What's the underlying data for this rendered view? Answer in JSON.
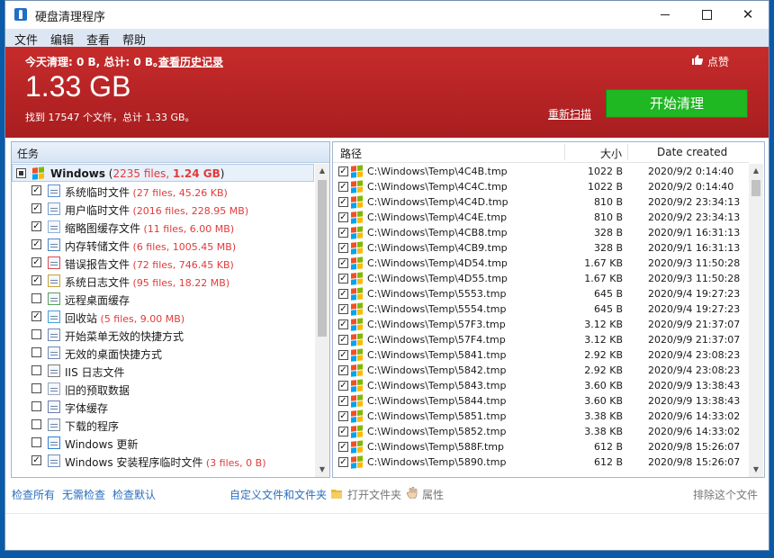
{
  "window": {
    "title": "硬盘清理程序"
  },
  "menu": [
    "文件",
    "编辑",
    "查看",
    "帮助"
  ],
  "banner": {
    "today": "今天清理: 0 B, 总计: 0 B。",
    "history": "查看历史记录",
    "like": "点赞",
    "total_size": "1.33 GB",
    "found": "找到 17547 个文件，总计 1.33 GB。",
    "rescan": "重新扫描",
    "start": "开始清理",
    "start_color": "#1fb722",
    "banner_color": "#b82426"
  },
  "tasks": {
    "header": "任务",
    "root": {
      "label": "Windows",
      "files": "2235 files,",
      "size": "1.24 GB"
    },
    "items": [
      {
        "label": "系统临时文件",
        "checked": true,
        "files": "27 files,",
        "size": "45.26 KB",
        "icon": "temp-icon"
      },
      {
        "label": "用户临时文件",
        "checked": true,
        "files": "2016 files,",
        "size": "228.95 MB",
        "icon": "user-temp-icon"
      },
      {
        "label": "缩略图缓存文件",
        "checked": true,
        "files": "11 files,",
        "size": "6.00 MB",
        "icon": "thumbnail-icon"
      },
      {
        "label": "内存转储文件",
        "checked": true,
        "files": "6 files,",
        "size": "1005.45 MB",
        "icon": "memory-dump-icon"
      },
      {
        "label": "错误报告文件",
        "checked": true,
        "files": "72 files,",
        "size": "746.45 KB",
        "icon": "error-report-icon"
      },
      {
        "label": "系统日志文件",
        "checked": true,
        "files": "95 files,",
        "size": "18.22 MB",
        "icon": "log-icon"
      },
      {
        "label": "远程桌面缓存",
        "checked": false,
        "files": "",
        "size": "",
        "icon": "remote-desktop-icon"
      },
      {
        "label": "回收站",
        "checked": true,
        "files": "5 files,",
        "size": "9.00 MB",
        "icon": "recycle-bin-icon"
      },
      {
        "label": "开始菜单无效的快捷方式",
        "checked": false,
        "files": "",
        "size": "",
        "icon": "shortcut-icon"
      },
      {
        "label": "无效的桌面快捷方式",
        "checked": false,
        "files": "",
        "size": "",
        "icon": "shortcut-icon"
      },
      {
        "label": "IIS 日志文件",
        "checked": false,
        "files": "",
        "size": "",
        "icon": "iis-log-icon"
      },
      {
        "label": "旧的预取数据",
        "checked": false,
        "files": "",
        "size": "",
        "icon": "prefetch-icon"
      },
      {
        "label": "字体缓存",
        "checked": false,
        "files": "",
        "size": "",
        "icon": "font-icon"
      },
      {
        "label": "下载的程序",
        "checked": false,
        "files": "",
        "size": "",
        "icon": "download-icon"
      },
      {
        "label": "Windows 更新",
        "checked": false,
        "files": "",
        "size": "",
        "icon": "windows-update-icon"
      },
      {
        "label": "Windows 安装程序临时文件",
        "checked": true,
        "files": "3 files,",
        "size": "0 B",
        "icon": "installer-icon"
      }
    ]
  },
  "files": {
    "col_path": "路径",
    "col_size": "大小",
    "col_date": "Date created",
    "rows": [
      {
        "path": "C:\\Windows\\Temp\\4C4B.tmp",
        "size": "1022 B",
        "date": "2020/9/2 0:14:40"
      },
      {
        "path": "C:\\Windows\\Temp\\4C4C.tmp",
        "size": "1022 B",
        "date": "2020/9/2 0:14:40"
      },
      {
        "path": "C:\\Windows\\Temp\\4C4D.tmp",
        "size": "810 B",
        "date": "2020/9/2 23:34:13"
      },
      {
        "path": "C:\\Windows\\Temp\\4C4E.tmp",
        "size": "810 B",
        "date": "2020/9/2 23:34:13"
      },
      {
        "path": "C:\\Windows\\Temp\\4CB8.tmp",
        "size": "328 B",
        "date": "2020/9/1 16:31:13"
      },
      {
        "path": "C:\\Windows\\Temp\\4CB9.tmp",
        "size": "328 B",
        "date": "2020/9/1 16:31:13"
      },
      {
        "path": "C:\\Windows\\Temp\\4D54.tmp",
        "size": "1.67 KB",
        "date": "2020/9/3 11:50:28"
      },
      {
        "path": "C:\\Windows\\Temp\\4D55.tmp",
        "size": "1.67 KB",
        "date": "2020/9/3 11:50:28"
      },
      {
        "path": "C:\\Windows\\Temp\\5553.tmp",
        "size": "645 B",
        "date": "2020/9/4 19:27:23"
      },
      {
        "path": "C:\\Windows\\Temp\\5554.tmp",
        "size": "645 B",
        "date": "2020/9/4 19:27:23"
      },
      {
        "path": "C:\\Windows\\Temp\\57F3.tmp",
        "size": "3.12 KB",
        "date": "2020/9/9 21:37:07"
      },
      {
        "path": "C:\\Windows\\Temp\\57F4.tmp",
        "size": "3.12 KB",
        "date": "2020/9/9 21:37:07"
      },
      {
        "path": "C:\\Windows\\Temp\\5841.tmp",
        "size": "2.92 KB",
        "date": "2020/9/4 23:08:23"
      },
      {
        "path": "C:\\Windows\\Temp\\5842.tmp",
        "size": "2.92 KB",
        "date": "2020/9/4 23:08:23"
      },
      {
        "path": "C:\\Windows\\Temp\\5843.tmp",
        "size": "3.60 KB",
        "date": "2020/9/9 13:38:43"
      },
      {
        "path": "C:\\Windows\\Temp\\5844.tmp",
        "size": "3.60 KB",
        "date": "2020/9/9 13:38:43"
      },
      {
        "path": "C:\\Windows\\Temp\\5851.tmp",
        "size": "3.38 KB",
        "date": "2020/9/6 14:33:02"
      },
      {
        "path": "C:\\Windows\\Temp\\5852.tmp",
        "size": "3.38 KB",
        "date": "2020/9/6 14:33:02"
      },
      {
        "path": "C:\\Windows\\Temp\\588F.tmp",
        "size": "612 B",
        "date": "2020/9/8 15:26:07"
      },
      {
        "path": "C:\\Windows\\Temp\\5890.tmp",
        "size": "612 B",
        "date": "2020/9/8 15:26:07"
      }
    ]
  },
  "bottom": {
    "check_all": "检查所有",
    "check_none": "无需检查",
    "check_default": "检查默认",
    "custom": "自定义文件和文件夹",
    "open_folder": "打开文件夹",
    "properties": "属性",
    "exclude": "排除这个文件"
  }
}
